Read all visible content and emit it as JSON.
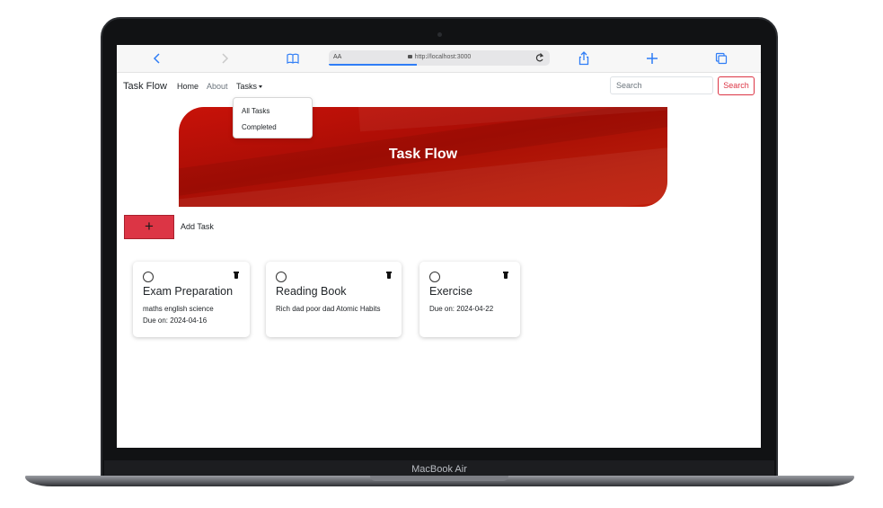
{
  "device": {
    "label": "MacBook Air"
  },
  "browser": {
    "text_size_label": "AA",
    "url": "http://localhost:3000",
    "load_progress": 0.4,
    "icons": [
      "back-icon",
      "forward-icon",
      "bookmarks-icon",
      "lock-icon",
      "reload-icon",
      "share-icon",
      "new-tab-icon",
      "tabs-icon"
    ]
  },
  "navbar": {
    "brand": "Task Flow",
    "links": [
      "Home",
      "About",
      "Tasks"
    ],
    "search_placeholder": "Search",
    "search_button": "Search"
  },
  "dropdown": {
    "items": [
      "All Tasks",
      "Completed"
    ]
  },
  "hero": {
    "title": "Task Flow"
  },
  "add_task": {
    "button_symbol": "+",
    "label": "Add Task"
  },
  "tasks": [
    {
      "title": "Exam Preparation",
      "description": "maths english science",
      "due": "Due on: 2024-04-16"
    },
    {
      "title": "Reading Book",
      "description": "Rich dad poor dad Atomic Habits",
      "due": ""
    },
    {
      "title": "Exercise",
      "description": "",
      "due": "Due on: 2024-04-22"
    }
  ],
  "colors": {
    "accent": "#dc3545",
    "hero": "#b0100a",
    "browser_blue": "#2f7df6"
  }
}
